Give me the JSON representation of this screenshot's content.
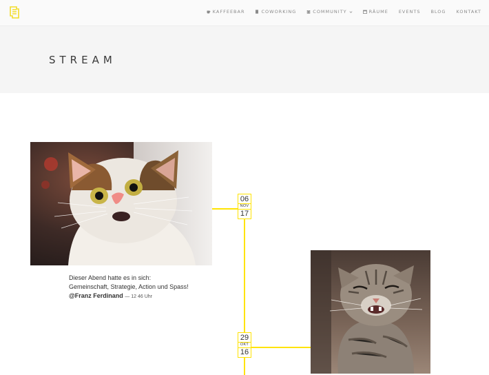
{
  "header": {
    "nav": [
      {
        "label": "KAFFEEBAR",
        "icon": "coffee-cup-icon"
      },
      {
        "label": "COWORKING",
        "icon": "building-icon"
      },
      {
        "label": "COMMUNITY",
        "icon": "group-icon",
        "dropdown": true
      },
      {
        "label": "RÄUME",
        "icon": "calendar-icon"
      },
      {
        "label": "EVENTS"
      },
      {
        "label": "BLOG"
      },
      {
        "label": "KONTAKT"
      }
    ]
  },
  "page": {
    "title": "STREAM"
  },
  "posts": [
    {
      "date": {
        "day": "06",
        "month": "NOV",
        "year": "17"
      },
      "image": "surprised-cat-photo",
      "text_line1": "Dieser Abend hatte es in sich:",
      "text_line2": "Gemeinschaft, Strategie, Action und Spass!",
      "author": "@Franz Ferdinand",
      "time": "— 12 46 Uhr"
    },
    {
      "date": {
        "day": "29",
        "month": "OKT",
        "year": "16"
      },
      "image": "grinning-tabby-cat-photo"
    }
  ],
  "colors": {
    "accent": "#ffe300",
    "banner_bg": "#f5f5f5",
    "nav_text": "#8a8a8a"
  }
}
